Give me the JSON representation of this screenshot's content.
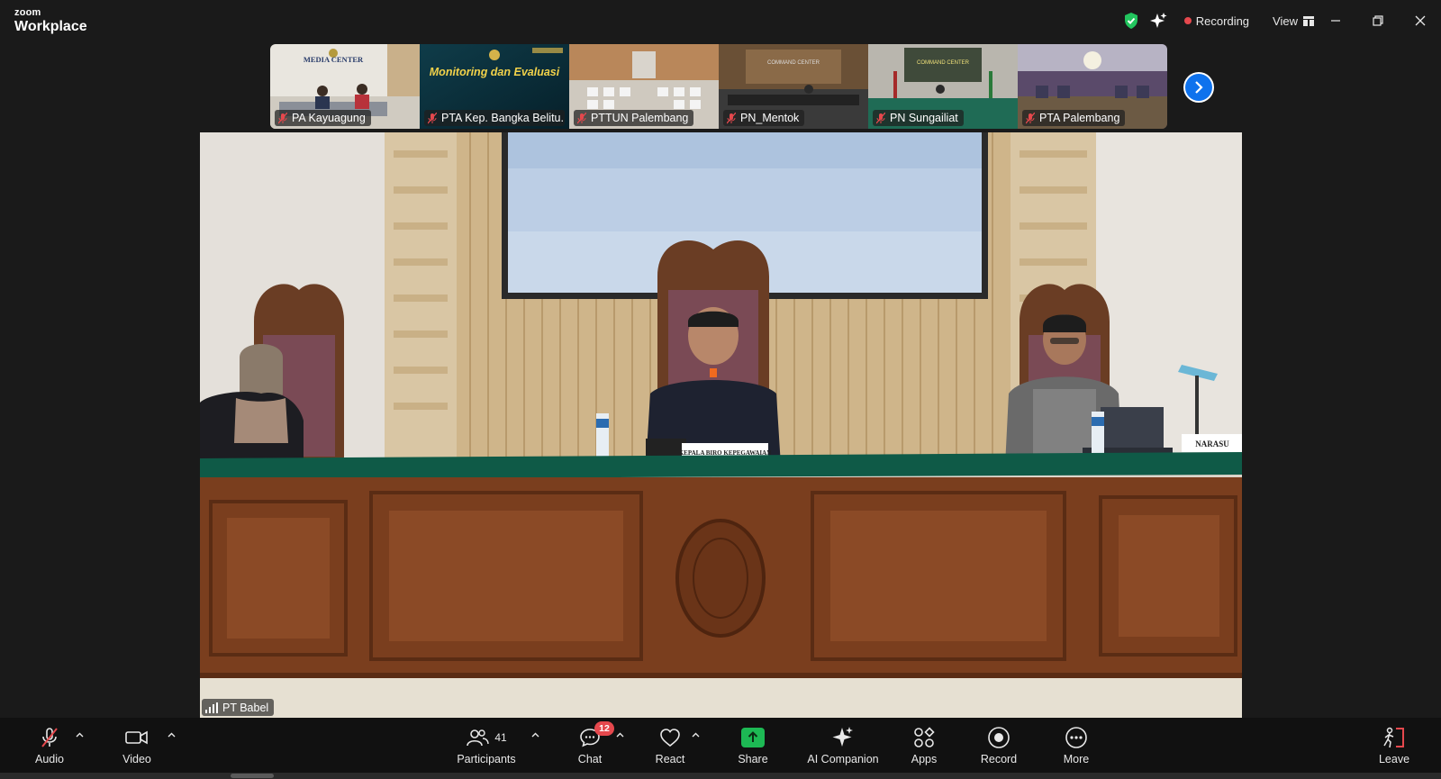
{
  "app": {
    "brand_line1": "zoom",
    "brand_line2": "Workplace"
  },
  "titlebar": {
    "recording_label": "Recording",
    "view_label": "View",
    "colors": {
      "shield": "#22c55e",
      "recording_dot": "#e5484d"
    }
  },
  "thumbnails": [
    {
      "name": "PA Kayuagung",
      "muted": true,
      "sign": "MEDIA CENTER"
    },
    {
      "name": "PTA Kep. Bangka Belitu...",
      "muted": true,
      "banner_title": "Monitoring dan Evaluasi"
    },
    {
      "name": "PTTUN Palembang",
      "muted": true
    },
    {
      "name": "PN_Mentok",
      "muted": true,
      "sign": "COMMAND CENTER"
    },
    {
      "name": "PN Sungailiat",
      "muted": true,
      "sign": "COMMAND CENTER"
    },
    {
      "name": "PTA Palembang",
      "muted": true
    }
  ],
  "main_video": {
    "speaker_name": "PT Babel",
    "nameplate_center": "KEPALA BIRO KEPEGAWAIAN",
    "nameplate_right": "NARASU"
  },
  "toolbar": {
    "audio": {
      "label": "Audio",
      "icon": "mic-muted-icon"
    },
    "video": {
      "label": "Video",
      "icon": "video-camera-icon"
    },
    "participants": {
      "label": "Participants",
      "count": "41",
      "icon": "participants-icon"
    },
    "chat": {
      "label": "Chat",
      "badge": "12",
      "icon": "chat-icon"
    },
    "react": {
      "label": "React",
      "icon": "heart-icon"
    },
    "share": {
      "label": "Share",
      "icon": "share-screen-icon",
      "color": "#1db954"
    },
    "ai_companion": {
      "label": "AI Companion",
      "icon": "sparkle-icon"
    },
    "apps": {
      "label": "Apps",
      "icon": "apps-icon"
    },
    "record": {
      "label": "Record",
      "icon": "record-icon"
    },
    "more": {
      "label": "More",
      "icon": "more-icon"
    },
    "leave": {
      "label": "Leave",
      "icon": "leave-icon",
      "color": "#e5484d"
    }
  }
}
